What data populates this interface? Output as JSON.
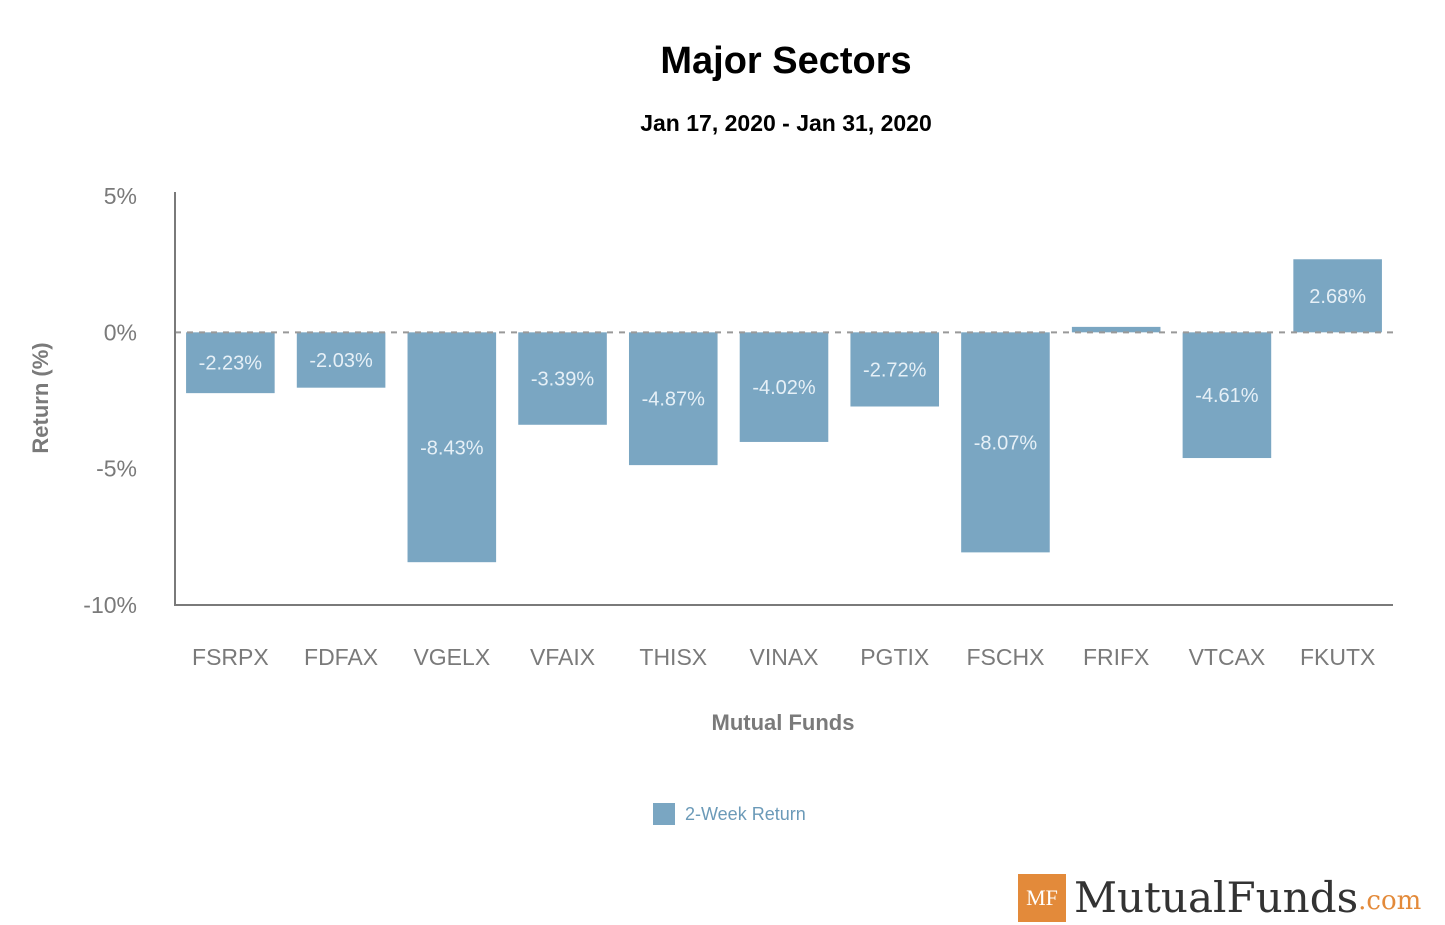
{
  "chart_data": {
    "type": "bar",
    "title": "Major Sectors",
    "subtitle": "Jan 17, 2020 - Jan 31, 2020",
    "xlabel": "Mutual Funds",
    "ylabel": "Return (%)",
    "ylim": [
      -10,
      5
    ],
    "yticks": [
      5,
      0,
      -5,
      -10
    ],
    "ytick_labels": [
      "5%",
      "0%",
      "-5%",
      "-10%"
    ],
    "categories": [
      "FSRPX",
      "FDFAX",
      "VGELX",
      "VFAIX",
      "THISX",
      "VINAX",
      "PGTIX",
      "FSCHX",
      "FRIFX",
      "VTCAX",
      "FKUTX"
    ],
    "series": [
      {
        "name": "2-Week Return",
        "color": "#7aa6c2",
        "values": [
          -2.23,
          -2.03,
          -8.43,
          -3.39,
          -4.87,
          -4.02,
          -2.72,
          -8.07,
          0.2,
          -4.61,
          2.68
        ],
        "data_labels": [
          "-2.23%",
          "-2.03%",
          "-8.43%",
          "-3.39%",
          "-4.87%",
          "-4.02%",
          "-2.72%",
          "-8.07%",
          "",
          "-4.61%",
          "2.68%"
        ]
      }
    ],
    "zero_line": "dashed",
    "grid": false,
    "legend_position": "bottom-center"
  },
  "legend": {
    "label": "2-Week Return"
  },
  "branding": {
    "badge": "MF",
    "name": "MutualFunds",
    "suffix": ".com"
  }
}
